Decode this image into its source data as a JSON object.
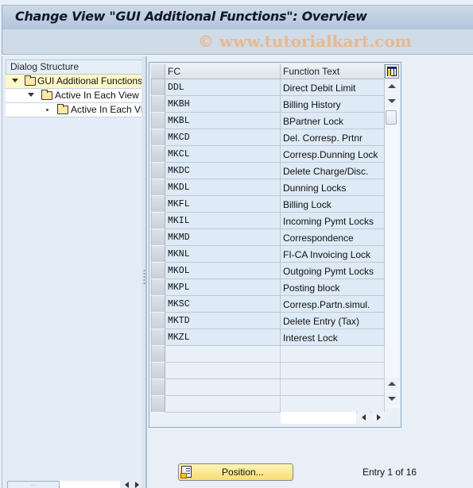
{
  "header": {
    "title": "Change View \"GUI Additional Functions\": Overview",
    "watermark": "© www.tutorialkart.com"
  },
  "dialog_structure": {
    "heading": "Dialog Structure",
    "items": [
      {
        "label": "GUI Additional Functions",
        "level": 0,
        "expanded": true,
        "selected": true
      },
      {
        "label": "Active In Each View",
        "level": 1,
        "expanded": true,
        "selected": false
      },
      {
        "label": "Active In Each View",
        "level": 2,
        "expanded": false,
        "selected": false
      }
    ]
  },
  "table": {
    "columns": [
      "FC",
      "Function Text"
    ],
    "rows": [
      {
        "fc": "DDL",
        "text": "Direct Debit Limit"
      },
      {
        "fc": "MKBH",
        "text": "Billing History"
      },
      {
        "fc": "MKBL",
        "text": "BPartner Lock"
      },
      {
        "fc": "MKCD",
        "text": "Del. Corresp. Prtnr"
      },
      {
        "fc": "MKCL",
        "text": "Corresp.Dunning Lock"
      },
      {
        "fc": "MKDC",
        "text": "Delete Charge/Disc."
      },
      {
        "fc": "MKDL",
        "text": "Dunning Locks"
      },
      {
        "fc": "MKFL",
        "text": "Billing Lock"
      },
      {
        "fc": "MKIL",
        "text": "Incoming Pymt Locks"
      },
      {
        "fc": "MKMD",
        "text": "Correspondence"
      },
      {
        "fc": "MKNL",
        "text": "FI-CA Invoicing Lock"
      },
      {
        "fc": "MKOL",
        "text": "Outgoing Pymt Locks"
      },
      {
        "fc": "MKPL",
        "text": "Posting block"
      },
      {
        "fc": "MKSC",
        "text": "Corresp.Partn.simul."
      },
      {
        "fc": "MKTD",
        "text": "Delete Entry (Tax)"
      },
      {
        "fc": "MKZL",
        "text": "Interest Lock"
      }
    ],
    "empty_rows": 4
  },
  "footer": {
    "position_button": "Position...",
    "entry_info": "Entry 1 of 16"
  }
}
